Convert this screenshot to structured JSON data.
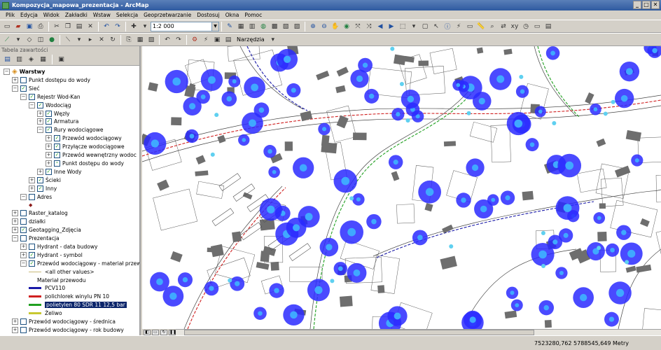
{
  "window": {
    "title": "Kompozycja_mapowa_prezentacja - ArcMap"
  },
  "window_buttons": {
    "minimize": "_",
    "maximize": "□",
    "close": "✕"
  },
  "menu": [
    "Plik",
    "Edycja",
    "Widok",
    "Zakładki",
    "Wstaw",
    "Selekcja",
    "Geoprzetwarzanie",
    "Dostosuj",
    "Okna",
    "Pomoc"
  ],
  "toolbar": {
    "scale_value": "1:2 000",
    "narzedzia_label": "Narzędzia"
  },
  "toc": {
    "title": "Tabela zawartości",
    "items": [
      {
        "label": "Warstwy",
        "level": 0,
        "exp": "−",
        "cb": false,
        "icon": "layers-icon",
        "bold": true
      },
      {
        "label": "Punkt dostępu do wody",
        "level": 1,
        "exp": "+",
        "cb": "off"
      },
      {
        "label": "Sieć",
        "level": 1,
        "exp": "−",
        "cb": "on"
      },
      {
        "label": "Rejestr Wod-Kan",
        "level": 2,
        "exp": "−",
        "cb": "on"
      },
      {
        "label": "Wodociąg",
        "level": 3,
        "exp": "−",
        "cb": "on"
      },
      {
        "label": "Węzły",
        "level": 4,
        "exp": "+",
        "cb": "on"
      },
      {
        "label": "Armatura",
        "level": 4,
        "exp": "+",
        "cb": "on"
      },
      {
        "label": "Rury wodociągowe",
        "level": 4,
        "exp": "−",
        "cb": "on"
      },
      {
        "label": "Przewód wodociągowy",
        "level": 5,
        "exp": "+",
        "cb": "on"
      },
      {
        "label": "Przyłącze wodociągowe",
        "level": 5,
        "exp": "+",
        "cb": "on"
      },
      {
        "label": "Przewód wewnętrzny wodoc",
        "level": 5,
        "exp": "+",
        "cb": "on"
      },
      {
        "label": "Punkt dostępu do wody",
        "level": 5,
        "exp": "+",
        "cb": "part"
      },
      {
        "label": "Inne Wody",
        "level": 4,
        "exp": "+",
        "cb": "on"
      },
      {
        "label": "Ścieki",
        "level": 3,
        "exp": "+",
        "cb": "on"
      },
      {
        "label": "Inny",
        "level": 3,
        "exp": "+",
        "cb": "on"
      },
      {
        "label": "Adres",
        "level": 2,
        "exp": "−",
        "cb": "off"
      },
      {
        "label": "",
        "level": 3,
        "exp": "",
        "cb": false,
        "symbol": "diamond"
      },
      {
        "label": "Raster_katalog",
        "level": 1,
        "exp": "+",
        "cb": "off"
      },
      {
        "label": "działki",
        "level": 1,
        "exp": "+",
        "cb": "off"
      },
      {
        "label": "Geotagging_Zdjęcia",
        "level": 1,
        "exp": "+",
        "cb": "on"
      },
      {
        "label": "Prezentacja",
        "level": 1,
        "exp": "−",
        "cb": "off"
      },
      {
        "label": "Hydrant - data budowy",
        "level": 2,
        "exp": "+",
        "cb": "off"
      },
      {
        "label": "Hydrant - symbol",
        "level": 2,
        "exp": "+",
        "cb": "on"
      },
      {
        "label": "Przewód wodociągowy - materiał przew",
        "level": 2,
        "exp": "−",
        "cb": "on"
      },
      {
        "label": "<all other values>",
        "level": 3,
        "exp": "",
        "cb": false,
        "swatch": "#c8b878",
        "swatch_h": 1
      },
      {
        "label": "Materiał przewodu",
        "level": 3,
        "exp": "",
        "cb": false
      },
      {
        "label": "PCV110",
        "level": 3,
        "exp": "",
        "cb": false,
        "swatch": "#1a1aa8",
        "swatch_h": 3
      },
      {
        "label": "polichlorek winylu PN 10",
        "level": 3,
        "exp": "",
        "cb": false,
        "swatch": "#d02020",
        "swatch_h": 3
      },
      {
        "label": "polietylen 80  SDR  11  12,5 bar",
        "level": 3,
        "exp": "",
        "cb": false,
        "swatch": "#20a020",
        "swatch_h": 3,
        "selected": true
      },
      {
        "label": "Żeliwo",
        "level": 3,
        "exp": "",
        "cb": false,
        "swatch": "#c8c830",
        "swatch_h": 3
      },
      {
        "label": "Przewód wodociągowy - średnica",
        "level": 1,
        "exp": "+",
        "cb": "off"
      },
      {
        "label": "Przewód wodociągowy - rok budowy",
        "level": 1,
        "exp": "+",
        "cb": "off"
      }
    ]
  },
  "status": {
    "coordinates": "7523280,762  5788545,649 Metry"
  },
  "colors": {
    "hydrant_outer": "#2a2aff",
    "hydrant_inner": "#3fa9ff",
    "building": "#6e6e6e",
    "parcel": "#5a5a5a"
  },
  "map_symbols": [
    {
      "kind": "hydrant",
      "size": "large"
    },
    {
      "kind": "hydrant",
      "size": "small"
    },
    {
      "kind": "point",
      "color": "cyan"
    }
  ]
}
